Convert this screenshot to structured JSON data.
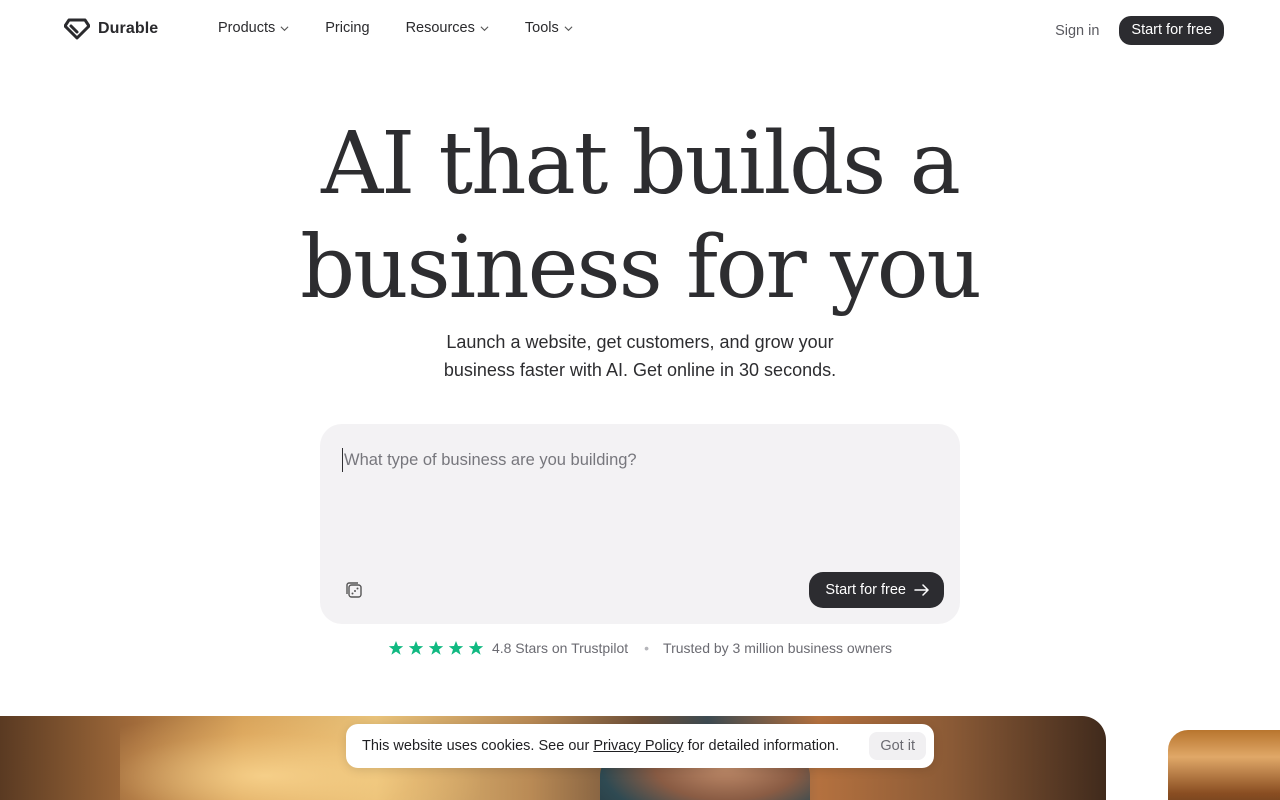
{
  "brand": {
    "name": "Durable",
    "logo_icon": "diamond-logo-icon"
  },
  "nav": {
    "items": [
      {
        "label": "Products",
        "has_dropdown": true
      },
      {
        "label": "Pricing",
        "has_dropdown": false
      },
      {
        "label": "Resources",
        "has_dropdown": true
      },
      {
        "label": "Tools",
        "has_dropdown": true
      }
    ],
    "sign_in": "Sign in",
    "cta": "Start for free"
  },
  "hero": {
    "title_line1": "AI that builds a",
    "title_line2": "business for you",
    "subtitle_line1": "Launch a website, get customers, and grow your",
    "subtitle_line2": "business faster with AI. Get online in 30 seconds."
  },
  "prompt": {
    "placeholder": "What type of business are you building?",
    "value": "",
    "randomize_icon": "dice-icon",
    "submit_label": "Start for free",
    "submit_icon": "arrow-right-icon"
  },
  "trust": {
    "stars": 5,
    "star_color": "#10b981",
    "rating_text": "4.8 Stars on Trustpilot",
    "separator": "•",
    "trusted_text": "Trusted by 3 million business owners"
  },
  "cookie": {
    "text_before": "This website uses cookies. See our",
    "link": "Privacy Policy",
    "text_after": "for detailed information.",
    "button": "Got it"
  },
  "colors": {
    "dark_button": "#2c2c30",
    "prompt_bg": "#f3f2f4",
    "text": "#2d2d30"
  }
}
